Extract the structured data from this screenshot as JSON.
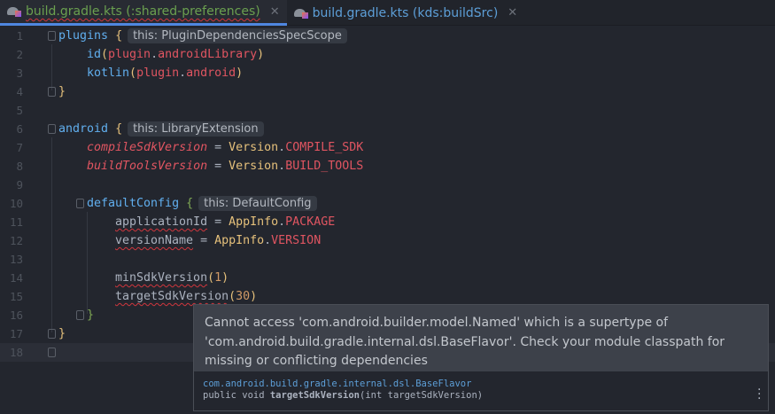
{
  "tabs": [
    {
      "label": "build.gradle.kts (:shared-preferences)",
      "active": true,
      "icon": "gradle-kotlin-file-icon"
    },
    {
      "label": "build.gradle.kts (kds:buildSrc)",
      "active": false,
      "icon": "gradle-kotlin-file-icon"
    }
  ],
  "current_line": 18,
  "lines": [
    {
      "n": "1",
      "ind": 0,
      "fold": true,
      "tokens": [
        [
          "plugins",
          "fn"
        ],
        [
          " ",
          "op"
        ],
        [
          "{",
          "br2"
        ]
      ],
      "hint": "this: PluginDependenciesSpecScope"
    },
    {
      "n": "2",
      "ind": 4,
      "tokens": [
        [
          "id",
          "fn"
        ],
        [
          "(",
          "br2"
        ],
        [
          "plugin",
          "prop"
        ],
        [
          ".",
          "op"
        ],
        [
          "androidLibrary",
          "prop"
        ],
        [
          ")",
          "br2"
        ]
      ]
    },
    {
      "n": "3",
      "ind": 4,
      "tokens": [
        [
          "kotlin",
          "fn"
        ],
        [
          "(",
          "br2"
        ],
        [
          "plugin",
          "prop"
        ],
        [
          ".",
          "op"
        ],
        [
          "android",
          "prop"
        ],
        [
          ")",
          "br2"
        ]
      ]
    },
    {
      "n": "4",
      "ind": 0,
      "fold": true,
      "tokens": [
        [
          "}",
          "br2"
        ]
      ]
    },
    {
      "n": "5",
      "ind": 0,
      "tokens": []
    },
    {
      "n": "6",
      "ind": 0,
      "fold": true,
      "tokens": [
        [
          "android",
          "fn"
        ],
        [
          " ",
          "op"
        ],
        [
          "{",
          "br2"
        ]
      ],
      "hint": "this: LibraryExtension"
    },
    {
      "n": "7",
      "ind": 4,
      "tokens": [
        [
          "compileSdkVersion",
          "it"
        ],
        [
          " = ",
          "op"
        ],
        [
          "Version",
          "cls"
        ],
        [
          ".",
          "op"
        ],
        [
          "COMPILE_SDK",
          "prop"
        ]
      ]
    },
    {
      "n": "8",
      "ind": 4,
      "tokens": [
        [
          "buildToolsVersion",
          "it"
        ],
        [
          " = ",
          "op"
        ],
        [
          "Version",
          "cls"
        ],
        [
          ".",
          "op"
        ],
        [
          "BUILD_TOOLS",
          "prop"
        ]
      ]
    },
    {
      "n": "9",
      "ind": 0,
      "tokens": []
    },
    {
      "n": "10",
      "ind": 4,
      "fold": true,
      "tokens": [
        [
          "defaultConfig",
          "fn"
        ],
        [
          " ",
          "op"
        ],
        [
          "{",
          "brg"
        ]
      ],
      "hint": "this: DefaultConfig"
    },
    {
      "n": "11",
      "ind": 8,
      "tokens": [
        [
          "applicationId",
          "plain err"
        ],
        [
          " = ",
          "op"
        ],
        [
          "AppInfo",
          "cls"
        ],
        [
          ".",
          "op"
        ],
        [
          "PACKAGE",
          "prop"
        ]
      ]
    },
    {
      "n": "12",
      "ind": 8,
      "tokens": [
        [
          "versionName",
          "plain err"
        ],
        [
          " = ",
          "op"
        ],
        [
          "AppInfo",
          "cls"
        ],
        [
          ".",
          "op"
        ],
        [
          "VERSION",
          "prop"
        ]
      ]
    },
    {
      "n": "13",
      "ind": 0,
      "tokens": []
    },
    {
      "n": "14",
      "ind": 8,
      "tokens": [
        [
          "minSdkVersion",
          "plain err"
        ],
        [
          "(",
          "br2"
        ],
        [
          "1",
          "num"
        ],
        [
          ")",
          "br2"
        ]
      ]
    },
    {
      "n": "15",
      "ind": 8,
      "tokens": [
        [
          "targetSdkVersion",
          "plain err"
        ],
        [
          "(",
          "br2"
        ],
        [
          "30",
          "num"
        ],
        [
          ")",
          "br2"
        ]
      ]
    },
    {
      "n": "16",
      "ind": 4,
      "fold": true,
      "tokens": [
        [
          "}",
          "brg"
        ]
      ]
    },
    {
      "n": "17",
      "ind": 0,
      "fold": true,
      "tokens": [
        [
          "}",
          "br2"
        ]
      ]
    },
    {
      "n": "18",
      "ind": 0,
      "fold": true,
      "tokens": []
    }
  ],
  "tooltip": {
    "message": "Cannot access 'com.android.builder.model.Named' which is a supertype of 'com.android.build.gradle.internal.dsl.BaseFlavor'. Check your module classpath for missing or conflicting dependencies",
    "doc_package": "com.android.build.gradle.internal.dsl.BaseFlavor",
    "doc_sig_prefix": "public void ",
    "doc_sig_name": "targetSdkVersion",
    "doc_sig_suffix": "(int targetSdkVersion)",
    "more_icon": "vertical-ellipsis-icon"
  }
}
